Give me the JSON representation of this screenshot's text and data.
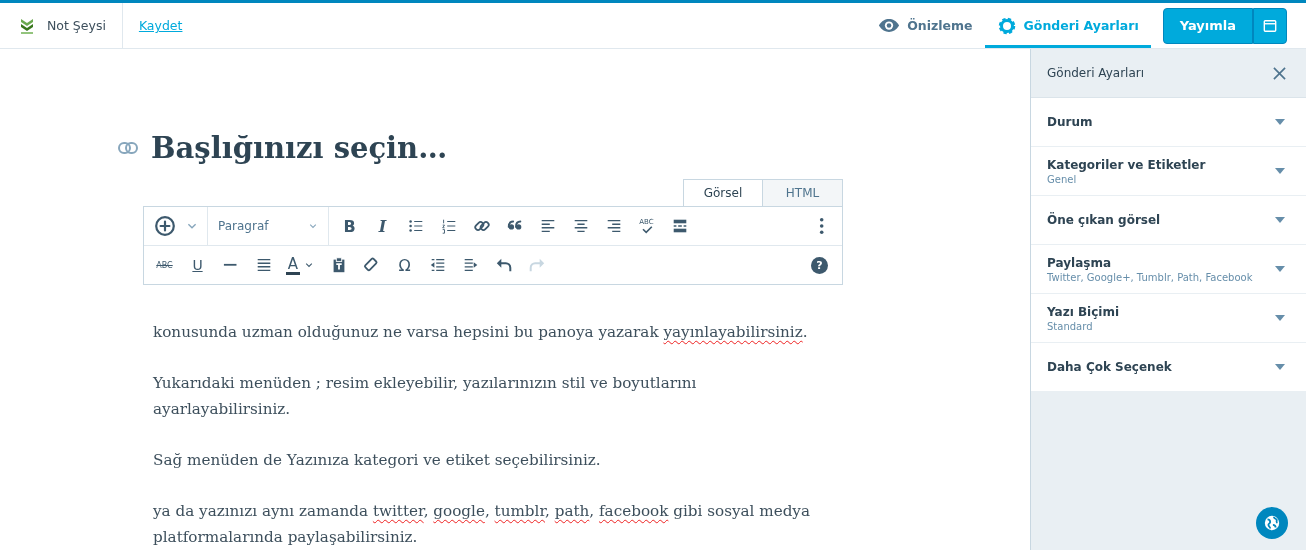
{
  "masthead": {
    "site_name": "Not Şeysi",
    "save_link": "Kaydet"
  },
  "nav": [
    {
      "label": "Önizleme",
      "kind": "eye",
      "selected": false
    },
    {
      "label": "Gönderi Ayarları",
      "kind": "gear",
      "selected": true
    }
  ],
  "publish_button": "Yayımla",
  "editor": {
    "title_placeholder": "Başlığınızı seçin…",
    "tabs": [
      {
        "label": "Görsel",
        "selected": true
      },
      {
        "label": "HTML",
        "selected": false
      }
    ],
    "toolbar": [
      [
        {
          "kind": "add",
          "disabled": false
        },
        {
          "kind": "caret",
          "disabled": false
        },
        {
          "kind": "format",
          "label": "Paragraf",
          "disabled": false
        },
        {
          "kind": "bold",
          "label": "B",
          "disabled": false
        },
        {
          "kind": "italic",
          "label": "I",
          "disabled": false
        },
        {
          "kind": "bullet-list",
          "disabled": false
        },
        {
          "kind": "numbered-list",
          "disabled": false
        },
        {
          "kind": "link",
          "disabled": false
        },
        {
          "kind": "quote",
          "disabled": false
        },
        {
          "kind": "align-left",
          "disabled": false
        },
        {
          "kind": "align-center",
          "disabled": false
        },
        {
          "kind": "align-right",
          "disabled": false
        },
        {
          "kind": "spellcheck",
          "label": "ABC",
          "disabled": false
        },
        {
          "kind": "read-more",
          "disabled": false
        },
        {
          "kind": "more",
          "disabled": false
        }
      ],
      [
        {
          "kind": "strikethrough",
          "label": "ABC",
          "disabled": false
        },
        {
          "kind": "underline",
          "label": "U",
          "disabled": false
        },
        {
          "kind": "horizontal-rule",
          "disabled": false
        },
        {
          "kind": "justify",
          "disabled": false
        },
        {
          "kind": "text-color",
          "label": "A",
          "disabled": false
        },
        {
          "kind": "paste-text",
          "disabled": false
        },
        {
          "kind": "eraser",
          "disabled": false
        },
        {
          "kind": "omega",
          "label": "Ω",
          "disabled": false
        },
        {
          "kind": "outdent",
          "disabled": false
        },
        {
          "kind": "indent",
          "disabled": false
        },
        {
          "kind": "undo",
          "disabled": false
        },
        {
          "kind": "redo",
          "disabled": true
        },
        {
          "kind": "help",
          "label": "?",
          "disabled": false
        }
      ]
    ],
    "paragraphs": [
      {
        "lines": [
          [
            {
              "text": "konusunda uzman olduğunuz ne varsa hepsini bu panoya yazarak "
            },
            {
              "text": "yayınlayabilirsiniz",
              "misspelled": true
            },
            {
              "text": "."
            }
          ]
        ]
      },
      {
        "lines": [
          [
            {
              "text": "Yukarıdaki menüden ; resim ekleyebilir, yazılarınızın stil ve boyutlarını"
            }
          ],
          [
            {
              "text": "ayarlayabilirsiniz."
            }
          ]
        ]
      },
      {
        "lines": [
          [
            {
              "text": "Sağ menüden de Yazınıza kategori ve etiket seçebilirsiniz."
            }
          ]
        ]
      },
      {
        "lines": [
          [
            {
              "text": "ya da yazınızı aynı zamanda "
            },
            {
              "text": "twitter",
              "misspelled": true
            },
            {
              "text": ", "
            },
            {
              "text": "google",
              "misspelled": true
            },
            {
              "text": ", "
            },
            {
              "text": "tumblr",
              "misspelled": true
            },
            {
              "text": ", "
            },
            {
              "text": "path",
              "misspelled": true
            },
            {
              "text": ", "
            },
            {
              "text": "facebook",
              "misspelled": true
            },
            {
              "text": " gibi sosyal medya"
            }
          ],
          [
            {
              "text": "platformalarında paylaşabilirsiniz."
            }
          ]
        ]
      }
    ]
  },
  "sidebar": {
    "title": "Gönderi Ayarları",
    "sections": [
      {
        "title": "Durum"
      },
      {
        "title": "Kategoriler ve Etiketler",
        "subtitle": "Genel"
      },
      {
        "title": "Öne çıkan görsel"
      },
      {
        "title": "Paylaşma",
        "subtitle": "Twitter, Google+, Tumblr, Path, Facebook"
      },
      {
        "title": "Yazı Biçimi",
        "subtitle": "Standard"
      },
      {
        "title": "Daha Çok Seçenek"
      }
    ]
  }
}
